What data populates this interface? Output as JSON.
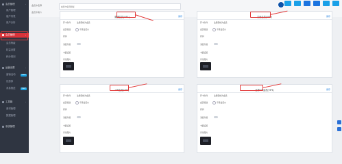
{
  "sidebar": {
    "items": [
      {
        "label": "会员管理",
        "type": "main"
      },
      {
        "label": "用户管理",
        "type": "sub"
      },
      {
        "label": "客户列表",
        "type": "sub"
      },
      {
        "label": "用户分析",
        "type": "sub"
      },
      {
        "label": "会员管理",
        "type": "active"
      },
      {
        "label": "会员等级",
        "type": "sub"
      },
      {
        "label": "权益设置",
        "type": "sub"
      },
      {
        "label": "积分规则",
        "type": "sub"
      },
      {
        "label": "运营设置",
        "type": "main"
      },
      {
        "label": "营销活动",
        "type": "sub",
        "badge": "NEW"
      },
      {
        "label": "优惠券",
        "type": "sub"
      },
      {
        "label": "消息推送",
        "type": "sub",
        "badge": "NEW"
      },
      {
        "label": "工具箱",
        "type": "main"
      },
      {
        "label": "素材管理",
        "type": "sub"
      },
      {
        "label": "数据管理",
        "type": "sub"
      },
      {
        "label": "系统管理",
        "type": "main"
      }
    ]
  },
  "topbar": {
    "row1_label": "会员卡名称",
    "row2_label": "会员卡简介",
    "input_value": "会员卡名称测试"
  },
  "panels": [
    {
      "title": "普通会员(VIP1)",
      "save": "保存",
      "fields": [
        "开卡条件",
        "注册即成为会员",
        "会员权益",
        "享受会员价",
        "折扣",
        "消费升级",
        "卡面设置",
        "背景图片"
      ]
    },
    {
      "title": "高级会员(VIP2)",
      "save": "保存",
      "fields": [
        "开卡条件",
        "注册即成为会员",
        "会员权益",
        "享受会员价",
        "折扣",
        "消费升级",
        "卡面设置",
        "背景图片"
      ]
    },
    {
      "title": "VIP会员(VIP3)",
      "save": "保存",
      "fields": [
        "开卡条件",
        "注册即成为会员",
        "会员权益",
        "享受会员价",
        "折扣",
        "消费升级",
        "卡面设置",
        "背景图片"
      ]
    },
    {
      "title": "至尊VIP会员(VIP4)",
      "save": "保存",
      "fields": [
        "开卡条件",
        "注册即成为会员",
        "会员权益",
        "享受会员价",
        "折扣",
        "消费升级",
        "卡面设置",
        "背景图片"
      ]
    }
  ]
}
